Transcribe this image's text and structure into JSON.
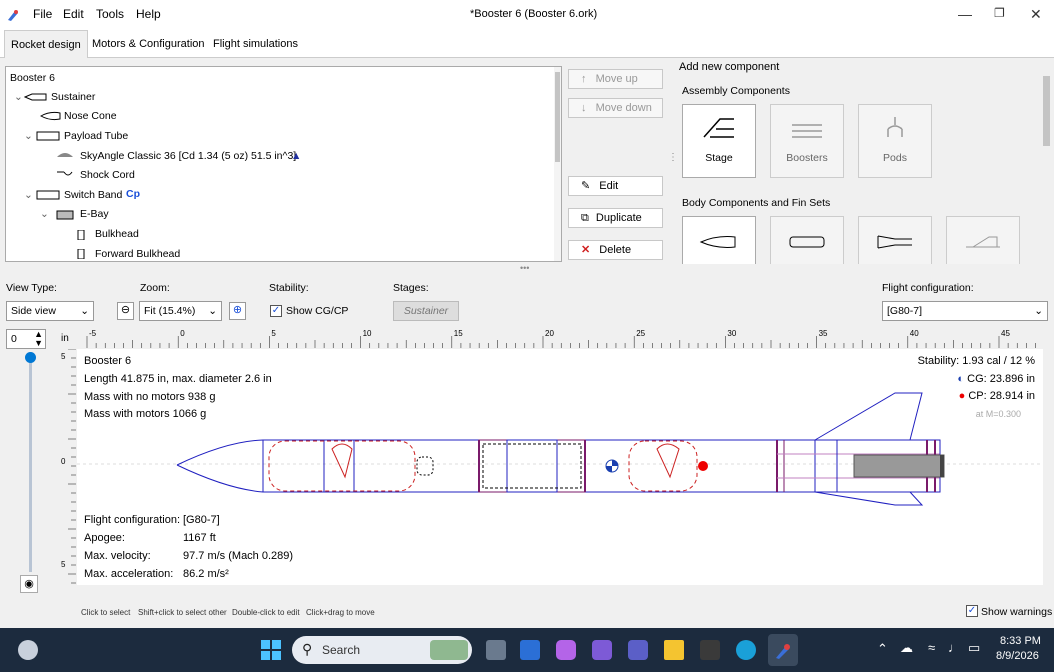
{
  "window": {
    "title": "*Booster 6 (Booster 6.ork)",
    "menu": [
      "File",
      "Edit",
      "Tools",
      "Help"
    ]
  },
  "tabs": [
    "Rocket design",
    "Motors & Configuration",
    "Flight simulations"
  ],
  "tree": {
    "root": "Booster 6",
    "items": [
      "Sustainer",
      "Nose Cone",
      "Payload Tube",
      "SkyAngle Classic 36 [Cd 1.34 (5 oz) 51.5 in^3]",
      "Shock Cord",
      "Switch Band",
      "E-Bay",
      "Bulkhead",
      "Forward Bulkhead"
    ],
    "cp_badge": "Cp"
  },
  "actions": {
    "move_up": "Move up",
    "move_down": "Move down",
    "edit": "Edit",
    "duplicate": "Duplicate",
    "delete": "Delete"
  },
  "components": {
    "title": "Add new component",
    "assembly_heading": "Assembly Components",
    "assembly": [
      "Stage",
      "Boosters",
      "Pods"
    ],
    "body_heading": "Body Components and Fin Sets"
  },
  "view": {
    "view_type_label": "View Type:",
    "view_type_value": "Side view",
    "zoom_label": "Zoom:",
    "zoom_value": "Fit (15.4%)",
    "stability_label": "Stability:",
    "show_cgcp": "Show CG/CP",
    "stages_label": "Stages:",
    "stage_button": "Sustainer",
    "flight_config_label": "Flight configuration:",
    "flight_config_value": "[G80-7]",
    "rotation_value": "0",
    "unit": "in"
  },
  "ruler": {
    "ticks": [
      "-5",
      "0",
      "5",
      "10",
      "15",
      "20",
      "25",
      "30",
      "35",
      "40",
      "45"
    ],
    "vticks": [
      "5",
      "0",
      "5"
    ]
  },
  "figure": {
    "name": "Booster 6",
    "length": "Length 41.875 in, max. diameter 2.6 in",
    "mass_no_motors": "Mass with no motors 938 g",
    "mass_with_motors": "Mass with motors 1066 g",
    "stability": "Stability: 1.93 cal / 12 %",
    "cg": "CG: 23.896 in",
    "cp": "CP: 28.914 in",
    "mach": "at M=0.300",
    "flight_config_label": "Flight configuration:",
    "flight_config_value": "[G80-7]",
    "apogee_label": "Apogee:",
    "apogee_value": "1167 ft",
    "velocity_label": "Max. velocity:",
    "velocity_value": "97.7 m/s  (Mach 0.289)",
    "accel_label": "Max. acceleration:",
    "accel_value": "86.2 m/s²"
  },
  "status": {
    "hints": [
      "Click to select",
      "Shift+click to select other",
      "Double-click to edit",
      "Click+drag to move"
    ],
    "show_warnings": "Show warnings"
  },
  "taskbar": {
    "search": "Search",
    "time": "8:33 PM",
    "date": "8/9/2026"
  },
  "colors": {
    "accent": "#0078d4",
    "rocket_outline": "#2020c0",
    "chute": "#cc2222",
    "motor": "#555555"
  }
}
